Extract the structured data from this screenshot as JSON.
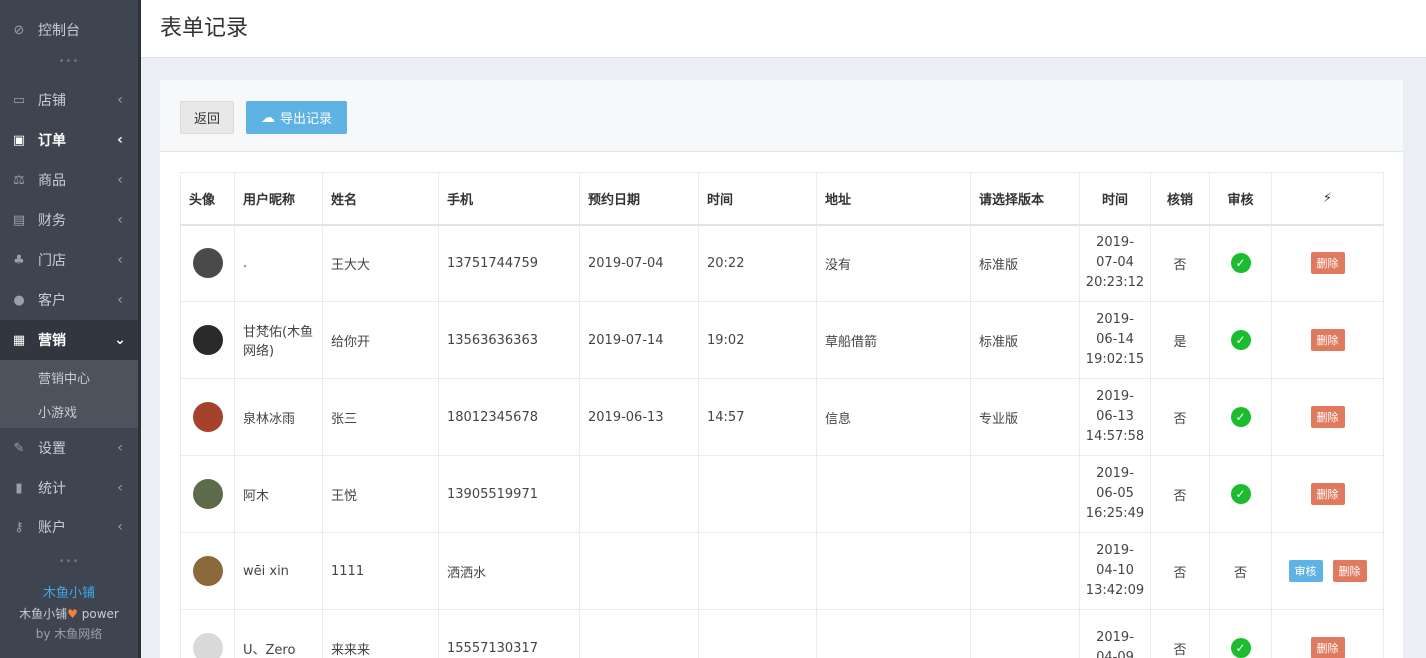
{
  "sidebar": {
    "items": [
      {
        "label": "控制台",
        "icon": "dashboard-icon",
        "glyph": "⊘"
      },
      {
        "label": "店铺",
        "icon": "basket-icon",
        "glyph": "▭"
      },
      {
        "label": "订单",
        "icon": "money-icon",
        "glyph": "▣"
      },
      {
        "label": "商品",
        "icon": "scale-icon",
        "glyph": "⚖"
      },
      {
        "label": "财务",
        "icon": "cash-icon",
        "glyph": "▤"
      },
      {
        "label": "门店",
        "icon": "sitemap-icon",
        "glyph": "♣"
      },
      {
        "label": "客户",
        "icon": "users-icon",
        "glyph": "●"
      },
      {
        "label": "营销",
        "icon": "gift-icon",
        "glyph": "▦"
      },
      {
        "label": "设置",
        "icon": "wrench-icon",
        "glyph": "✎"
      },
      {
        "label": "统计",
        "icon": "signal-icon",
        "glyph": "▮"
      },
      {
        "label": "账户",
        "icon": "key-icon",
        "glyph": "⚷"
      }
    ],
    "sub_items": [
      "营销中心",
      "小游戏"
    ],
    "separator": "•••",
    "footer": {
      "brand": "木鱼小铺",
      "power_prefix": "木鱼小铺",
      "power_suffix": " power",
      "by": "by 木鱼网络"
    }
  },
  "header": {
    "title": "表单记录"
  },
  "toolbar": {
    "back_label": "返回",
    "export_label": "导出记录"
  },
  "table": {
    "columns": [
      "头像",
      "用户昵称",
      "姓名",
      "手机",
      "预约日期",
      "时间",
      "地址",
      "请选择版本",
      "时间",
      "核销",
      "审核",
      "⚡"
    ],
    "rows": [
      {
        "nickname": ".",
        "name": "王大大",
        "phone": "13751744759",
        "date": "2019-07-04",
        "time": "20:22",
        "address": "没有",
        "version": "标准版",
        "created": [
          "2019-",
          "07-04",
          "20:23:12"
        ],
        "redeemed": "否",
        "review": "check",
        "avatar_color": "#4a4a4a"
      },
      {
        "nickname": "甘梵佑(木鱼网络)",
        "name": "给你开",
        "phone": "13563636363",
        "date": "2019-07-14",
        "time": "19:02",
        "address": "草船借箭",
        "version": "标准版",
        "created": [
          "2019-",
          "06-14",
          "19:02:15"
        ],
        "redeemed": "是",
        "review": "check",
        "avatar_color": "#2a2a2a"
      },
      {
        "nickname": "泉林冰雨",
        "name": "张三",
        "phone": "18012345678",
        "date": "2019-06-13",
        "time": "14:57",
        "address": "信息",
        "version": "专业版",
        "created": [
          "2019-",
          "06-13",
          "14:57:58"
        ],
        "redeemed": "否",
        "review": "check",
        "avatar_color": "#a5432a"
      },
      {
        "nickname": "阿木",
        "name": "王悦",
        "phone": "13905519971",
        "date": "",
        "time": "",
        "address": "",
        "version": "",
        "created": [
          "2019-",
          "06-05",
          "16:25:49"
        ],
        "redeemed": "否",
        "review": "check",
        "avatar_color": "#5e6b4a"
      },
      {
        "nickname": "wēi xin",
        "name": "1111",
        "phone": "洒洒水",
        "date": "",
        "time": "",
        "address": "",
        "version": "",
        "created": [
          "2019-",
          "04-10",
          "13:42:09"
        ],
        "redeemed": "否",
        "review": "否",
        "avatar_color": "#8a6a3a"
      },
      {
        "nickname": "U、Zero",
        "name": "来来来",
        "phone": "15557130317",
        "date": "",
        "time": "",
        "address": "",
        "version": "",
        "created": [
          "2019-",
          "04-09",
          ""
        ],
        "redeemed": "否",
        "review": "check",
        "avatar_color": "#d9d9d9"
      }
    ],
    "delete_label": "删除",
    "audit_label": "审核",
    "check_glyph": "✓"
  },
  "colors": {
    "sidebar_bg": "#3f4550",
    "accent_blue": "#5fb2e4",
    "delete_red": "#e07a5f",
    "check_green": "#1bbc2f"
  }
}
